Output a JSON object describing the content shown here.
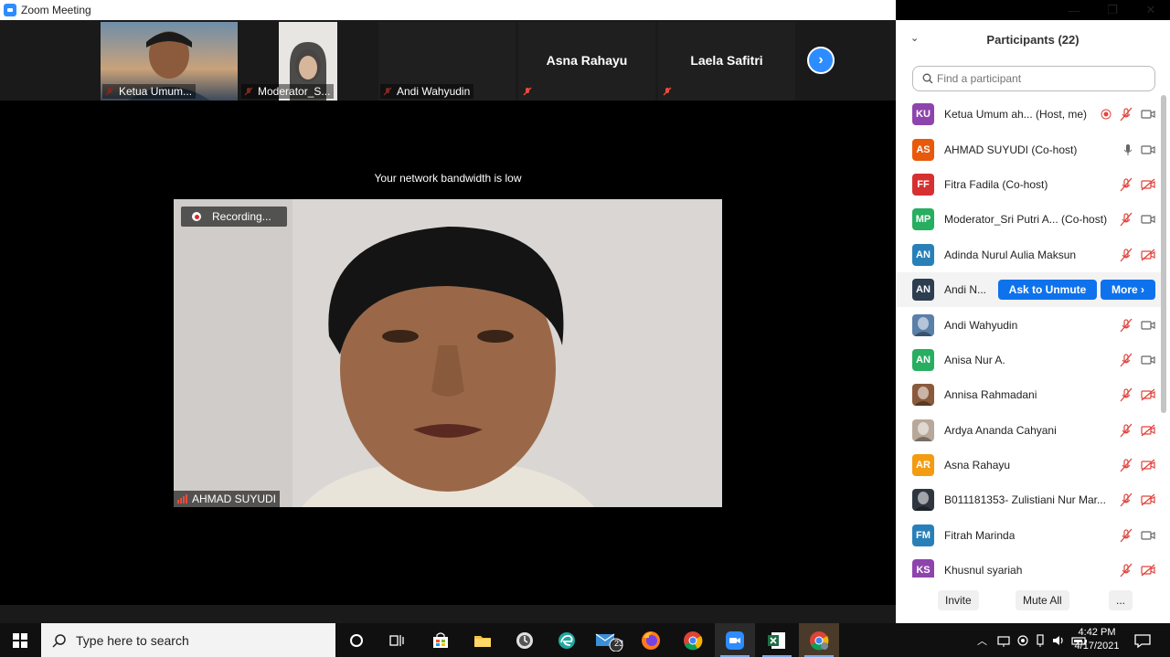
{
  "window": {
    "title": "Zoom Meeting"
  },
  "window_controls": {
    "minimize": "—",
    "restore": "❐",
    "close": "✕"
  },
  "strip": {
    "tiles": [
      {
        "name": "Ketua Umum..."
      },
      {
        "name": "Moderator_S..."
      },
      {
        "name": "Andi Wahyudin"
      },
      {
        "name": "Asna Rahayu"
      },
      {
        "name": "Laela Safitri"
      }
    ]
  },
  "stage": {
    "network_message": "Your network bandwidth is low",
    "recording_label": "Recording...",
    "speaker_name": "AHMAD SUYUDI"
  },
  "panel": {
    "title": "Participants (22)",
    "search_placeholder": "Find a participant",
    "ask_unmute_label": "Ask to Unmute",
    "more_label": "More ›",
    "participants": [
      {
        "initials": "KU",
        "name": "Ketua Umum ah...  (Host, me)",
        "color": "#8e44ad",
        "mic": "muted",
        "video": "on",
        "recording": true
      },
      {
        "initials": "AS",
        "name": "AHMAD SUYUDI (Co-host)",
        "color": "#e8590c",
        "mic": "on",
        "video": "on"
      },
      {
        "initials": "FF",
        "name": "Fitra Fadila (Co-host)",
        "color": "#d63031",
        "mic": "muted",
        "video": "off"
      },
      {
        "initials": "MP",
        "name": "Moderator_Sri Putri A... (Co-host)",
        "color": "#27ae60",
        "mic": "muted",
        "video": "on"
      },
      {
        "initials": "AN",
        "name": "Adinda Nurul Aulia Maksun",
        "color": "#2980b9",
        "mic": "muted",
        "video": "off"
      },
      {
        "initials": "AN",
        "name": "Andi N...",
        "color": "#2c3e50",
        "hover": true
      },
      {
        "initials": "",
        "name": "Andi Wahyudin",
        "color": "#5a7fa8",
        "photo": true,
        "mic": "muted",
        "video": "on"
      },
      {
        "initials": "AN",
        "name": "Anisa Nur A.",
        "color": "#27ae60",
        "mic": "muted",
        "video": "on"
      },
      {
        "initials": "",
        "name": "Annisa Rahmadani",
        "color": "#8a5a3c",
        "photo": true,
        "mic": "muted",
        "video": "off"
      },
      {
        "initials": "",
        "name": "Ardya Ananda Cahyani",
        "color": "#b8a89a",
        "photo": true,
        "mic": "muted",
        "video": "off"
      },
      {
        "initials": "AR",
        "name": "Asna Rahayu",
        "color": "#f39c12",
        "mic": "muted",
        "video": "off"
      },
      {
        "initials": "",
        "name": "B011181353- Zulistiani Nur Mar...",
        "color": "#2f3640",
        "photo": true,
        "mic": "muted",
        "video": "off"
      },
      {
        "initials": "FM",
        "name": "Fitrah Marinda",
        "color": "#2980b9",
        "mic": "muted",
        "video": "on"
      },
      {
        "initials": "KS",
        "name": "Khusnul syariah",
        "color": "#8e44ad",
        "mic": "muted",
        "video": "off"
      }
    ],
    "footer": {
      "invite": "Invite",
      "mute_all": "Mute All",
      "more": "..."
    }
  },
  "taskbar": {
    "search_placeholder": "Type here to search",
    "mail_badge": "23",
    "time": "4:42 PM",
    "date": "4/17/2021"
  }
}
